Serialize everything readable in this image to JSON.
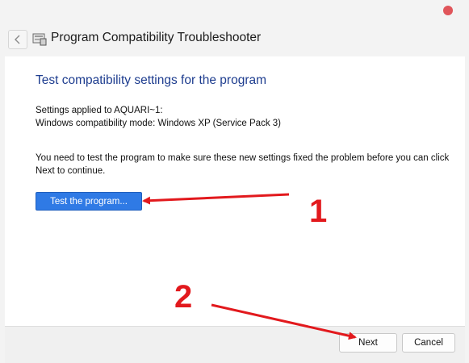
{
  "window": {
    "title": "Program Compatibility Troubleshooter",
    "icon": "troubleshooter-icon"
  },
  "content": {
    "heading": "Test compatibility settings for the program",
    "settings_applied": "Settings applied to AQUARI~1:",
    "compat_mode": "Windows compatibility mode: Windows XP (Service Pack 3)",
    "instructions": "You need to test the program to make sure these new settings fixed the problem before you can click Next to continue.",
    "test_button": "Test the program..."
  },
  "footer": {
    "next_label": "Next",
    "cancel_label": "Cancel"
  },
  "annotations": {
    "label_1": "1",
    "label_2": "2",
    "color": "#e2191d"
  },
  "colors": {
    "accent": "#2f7ae5",
    "heading": "#1e3d8f",
    "close_dot": "#e0555a"
  }
}
